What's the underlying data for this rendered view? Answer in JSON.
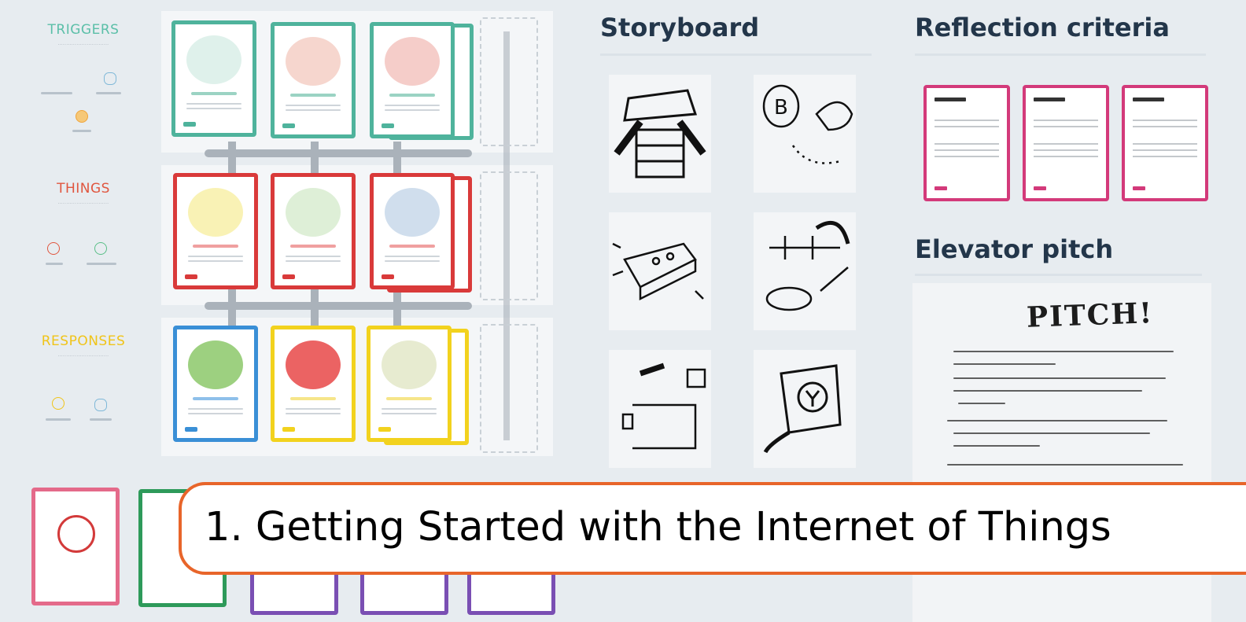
{
  "board": {
    "categories": [
      {
        "title": "TRIGGERS",
        "color": "#5bbfa8"
      },
      {
        "title": "THINGS",
        "color": "#e0563f"
      },
      {
        "title": "RESPONSES",
        "color": "#f0c419"
      }
    ],
    "headings": {
      "storyboard": "Storyboard",
      "reflection": "Reflection criteria",
      "elevator": "Elevator pitch"
    },
    "pitch_word": "PITCH!",
    "colors": {
      "trigger": "#4fb39c",
      "thing": "#d93a3a",
      "response_blue": "#3a8fd6",
      "response_yellow": "#f2d21e",
      "reflection": "#d33a7a",
      "purple": "#7a4fb3",
      "green": "#2e9a5a",
      "pink": "#e46a8a",
      "banner_border": "#e8652a"
    }
  },
  "banner": {
    "title": "1. Getting Started with the Internet of Things"
  }
}
